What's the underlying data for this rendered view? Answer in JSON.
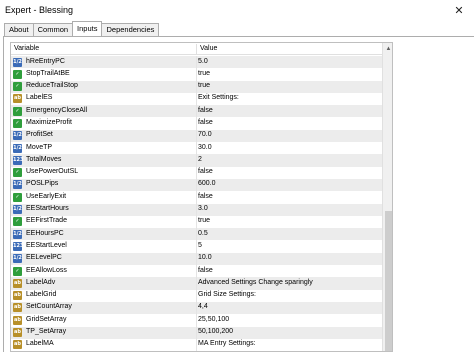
{
  "window": {
    "title": "Expert - Blessing",
    "close_glyph": "✕"
  },
  "tabs": [
    {
      "label": "About"
    },
    {
      "label": "Common"
    },
    {
      "label": "Inputs"
    },
    {
      "label": "Dependencies"
    }
  ],
  "active_tab": "Inputs",
  "grid": {
    "columns": {
      "variable": "Variable",
      "value": "Value"
    },
    "rows": [
      {
        "icon": "num",
        "icon_text": "1/2",
        "name": "hReEntryPC",
        "value": "5.0"
      },
      {
        "icon": "bool",
        "icon_text": "✓",
        "name": "StopTrailAtBE",
        "value": "true"
      },
      {
        "icon": "bool",
        "icon_text": "✓",
        "name": "ReduceTrailStop",
        "value": "true"
      },
      {
        "icon": "str",
        "icon_text": "ab",
        "name": "LabelES",
        "value": "Exit Settings:"
      },
      {
        "icon": "bool",
        "icon_text": "✓",
        "name": "EmergencyCloseAll",
        "value": "false"
      },
      {
        "icon": "bool",
        "icon_text": "✓",
        "name": "MaximizeProfit",
        "value": "false"
      },
      {
        "icon": "num",
        "icon_text": "1/2",
        "name": "ProfitSet",
        "value": "70.0"
      },
      {
        "icon": "num",
        "icon_text": "1/2",
        "name": "MoveTP",
        "value": "30.0"
      },
      {
        "icon": "int",
        "icon_text": "123",
        "name": "TotalMoves",
        "value": "2"
      },
      {
        "icon": "bool",
        "icon_text": "✓",
        "name": "UsePowerOutSL",
        "value": "false"
      },
      {
        "icon": "num",
        "icon_text": "1/2",
        "name": "POSLPips",
        "value": "600.0"
      },
      {
        "icon": "bool",
        "icon_text": "✓",
        "name": "UseEarlyExit",
        "value": "false"
      },
      {
        "icon": "num",
        "icon_text": "1/2",
        "name": "EEStartHours",
        "value": "3.0"
      },
      {
        "icon": "bool",
        "icon_text": "✓",
        "name": "EEFirstTrade",
        "value": "true"
      },
      {
        "icon": "num",
        "icon_text": "1/2",
        "name": "EEHoursPC",
        "value": "0.5"
      },
      {
        "icon": "int",
        "icon_text": "123",
        "name": "EEStartLevel",
        "value": "5"
      },
      {
        "icon": "num",
        "icon_text": "1/2",
        "name": "EELevelPC",
        "value": "10.0"
      },
      {
        "icon": "bool",
        "icon_text": "✓",
        "name": "EEAllowLoss",
        "value": "false"
      },
      {
        "icon": "str",
        "icon_text": "ab",
        "name": "LabelAdv",
        "value": "Advanced Settings Change sparingly"
      },
      {
        "icon": "str",
        "icon_text": "ab",
        "name": "LabelGrid",
        "value": "Grid Size Settings:"
      },
      {
        "icon": "str",
        "icon_text": "ab",
        "name": "SetCountArray",
        "value": "4,4"
      },
      {
        "icon": "str",
        "icon_text": "ab",
        "name": "GridSetArray",
        "value": "25,50,100"
      },
      {
        "icon": "str",
        "icon_text": "ab",
        "name": "TP_SetArray",
        "value": "50,100,200"
      },
      {
        "icon": "str",
        "icon_text": "ab",
        "name": "LabelMA",
        "value": "MA Entry Settings:"
      }
    ]
  },
  "colors": {
    "num_icon": "#3b6bb7",
    "bool_icon": "#2f9e3c",
    "str_icon": "#b8902a",
    "alt_row": "#ececec"
  },
  "icons": {
    "scroll_up": "▲"
  }
}
